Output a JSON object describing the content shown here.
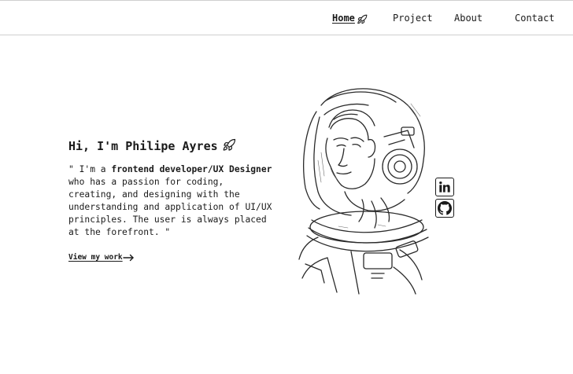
{
  "nav": {
    "home": "Home",
    "project": "Project",
    "about": "About",
    "contact": "Contact"
  },
  "hero": {
    "greeting": "Hi, I'm Philipe Ayres",
    "bio_open": "\" I'm a ",
    "bio_strong": "frontend developer/UX Designer",
    "bio_rest": " who has a passion for coding, creating, and designing with the understanding and application of UI/UX principles. The user is always placed at the forefront. \"",
    "cta": "View my work"
  },
  "icons": {
    "home_rocket": "rocket-icon",
    "greeting_rocket": "rocket-icon",
    "cta_arrow": "arrow-right-icon",
    "linkedin": "linkedin-icon",
    "github": "github-icon"
  },
  "colors": {
    "ink": "#1a1a1a",
    "background": "#ffffff",
    "rule": "#cfcfcf"
  }
}
